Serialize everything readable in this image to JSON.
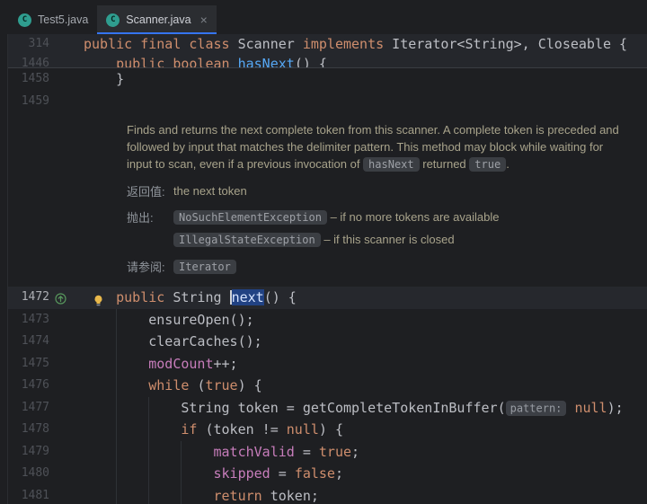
{
  "tabs": [
    {
      "label": "Test5.java",
      "active": false
    },
    {
      "label": "Scanner.java",
      "active": true
    }
  ],
  "icons": {
    "java": "java-class-icon",
    "close": "close-icon",
    "overrides": "overrides-method-icon",
    "bulb": "intention-bulb-icon"
  },
  "colors": {
    "keyword": "#cf8e6d",
    "method": "#56a8f5",
    "field": "#c77dbb",
    "plain": "#bcbec4",
    "selection": "#214283",
    "doc_text": "#a8a38b",
    "tab_underline": "#3574f0"
  },
  "editor": {
    "sticky_lines": [
      {
        "num": "314",
        "tokens": [
          {
            "c": "kw",
            "t": "public final class"
          },
          {
            "c": "pl",
            "t": " Scanner "
          },
          {
            "c": "kw",
            "t": "implements"
          },
          {
            "c": "pl",
            "t": " Iterator<String>, Closeable {"
          }
        ]
      },
      {
        "num": "1446",
        "clipped": true,
        "tokens": [
          {
            "c": "pl",
            "t": "    "
          },
          {
            "c": "kw",
            "t": "public boolean "
          },
          {
            "c": "mt",
            "t": "hasNext"
          },
          {
            "c": "pl",
            "t": "() {"
          }
        ]
      }
    ],
    "lines": [
      {
        "type": "code",
        "num": "1458",
        "tokens": [
          {
            "c": "pl",
            "t": "    }"
          }
        ]
      },
      {
        "type": "code",
        "num": "1459",
        "tokens": []
      },
      {
        "type": "doc"
      },
      {
        "type": "code",
        "num": "1472",
        "current": true,
        "gutter_icon": "overrides",
        "bulb": true,
        "tokens": [
          {
            "c": "pl",
            "t": "    "
          },
          {
            "c": "kw",
            "t": "public "
          },
          {
            "c": "pl",
            "t": "String "
          },
          {
            "c": "caret",
            "t": ""
          },
          {
            "c": "mt sel",
            "t": "next"
          },
          {
            "c": "pl",
            "t": "() {"
          }
        ]
      },
      {
        "type": "code",
        "num": "1473",
        "guides": [
          4
        ],
        "tokens": [
          {
            "c": "pl",
            "t": "        ensureOpen();"
          }
        ]
      },
      {
        "type": "code",
        "num": "1474",
        "guides": [
          4
        ],
        "tokens": [
          {
            "c": "pl",
            "t": "        clearCaches();"
          }
        ]
      },
      {
        "type": "code",
        "num": "1475",
        "guides": [
          4
        ],
        "tokens": [
          {
            "c": "pl",
            "t": "        "
          },
          {
            "c": "fd",
            "t": "modCount"
          },
          {
            "c": "pl",
            "t": "++;"
          }
        ]
      },
      {
        "type": "code",
        "num": "1476",
        "guides": [
          4
        ],
        "tokens": [
          {
            "c": "pl",
            "t": "        "
          },
          {
            "c": "kw",
            "t": "while "
          },
          {
            "c": "pl",
            "t": "("
          },
          {
            "c": "kw",
            "t": "true"
          },
          {
            "c": "pl",
            "t": ") {"
          }
        ]
      },
      {
        "type": "code",
        "num": "1477",
        "guides": [
          4,
          8
        ],
        "tokens": [
          {
            "c": "pl",
            "t": "            String token = getCompleteTokenInBuffer("
          },
          {
            "c": "hint",
            "t": "pattern:"
          },
          {
            "c": "pl",
            "t": " "
          },
          {
            "c": "kw",
            "t": "null"
          },
          {
            "c": "pl",
            "t": ");"
          }
        ]
      },
      {
        "type": "code",
        "num": "1478",
        "guides": [
          4,
          8
        ],
        "tokens": [
          {
            "c": "pl",
            "t": "            "
          },
          {
            "c": "kw",
            "t": "if "
          },
          {
            "c": "pl",
            "t": "(token != "
          },
          {
            "c": "kw",
            "t": "null"
          },
          {
            "c": "pl",
            "t": ") {"
          }
        ]
      },
      {
        "type": "code",
        "num": "1479",
        "guides": [
          4,
          8,
          12
        ],
        "tokens": [
          {
            "c": "pl",
            "t": "                "
          },
          {
            "c": "fd",
            "t": "matchValid"
          },
          {
            "c": "pl",
            "t": " = "
          },
          {
            "c": "kw",
            "t": "true"
          },
          {
            "c": "pl",
            "t": ";"
          }
        ]
      },
      {
        "type": "code",
        "num": "1480",
        "guides": [
          4,
          8,
          12
        ],
        "tokens": [
          {
            "c": "pl",
            "t": "                "
          },
          {
            "c": "fd",
            "t": "skipped"
          },
          {
            "c": "pl",
            "t": " = "
          },
          {
            "c": "kw",
            "t": "false"
          },
          {
            "c": "pl",
            "t": ";"
          }
        ]
      },
      {
        "type": "code",
        "num": "1481",
        "guides": [
          4,
          8,
          12
        ],
        "tokens": [
          {
            "c": "pl",
            "t": "                "
          },
          {
            "c": "kw",
            "t": "return"
          },
          {
            "c": "pl",
            "t": " token;"
          }
        ]
      }
    ]
  },
  "doc": {
    "paragraph_lines": [
      [
        {
          "t": "Finds and returns the next complete token from this scanner. A complete token is preceded and"
        }
      ],
      [
        {
          "t": "followed by input that matches the delimiter pattern. This method may block while waiting for"
        }
      ],
      [
        {
          "t": "input to scan, even if a previous invocation of "
        },
        {
          "t": "hasNext",
          "chip": true,
          "link": true
        },
        {
          "t": " returned "
        },
        {
          "t": "true",
          "chip": true
        },
        {
          "t": "."
        }
      ]
    ],
    "sections": [
      {
        "label": "返回值:",
        "rows": [
          [
            {
              "t": "the next token"
            }
          ]
        ]
      },
      {
        "label": "抛出:",
        "rows": [
          [
            {
              "t": "NoSuchElementException",
              "chip": true,
              "link": true
            },
            {
              "t": " – if no more tokens are available"
            }
          ],
          [
            {
              "t": "IllegalStateException",
              "chip": true,
              "link": true
            },
            {
              "t": " – if this scanner is closed"
            }
          ]
        ]
      },
      {
        "label": "请参阅:",
        "rows": [
          [
            {
              "t": "Iterator",
              "chip": true,
              "link": true
            }
          ]
        ]
      }
    ]
  }
}
